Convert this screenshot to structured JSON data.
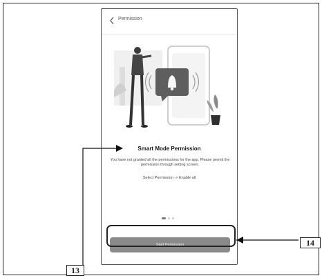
{
  "phone": {
    "topbar_title": "Permission",
    "heading": "Smart Mode Permission",
    "description": "You have not granted all the permissions for the app. Please permit the permission through setting screen.",
    "instruction": "Select Permission -> Enable all",
    "start_button": "Start Permission",
    "pager": {
      "page": 1,
      "total": 3
    }
  },
  "callouts": {
    "label_13": "13",
    "label_14": "14"
  },
  "colors": {
    "button": "#8a8a8a",
    "frame": "#222222"
  }
}
